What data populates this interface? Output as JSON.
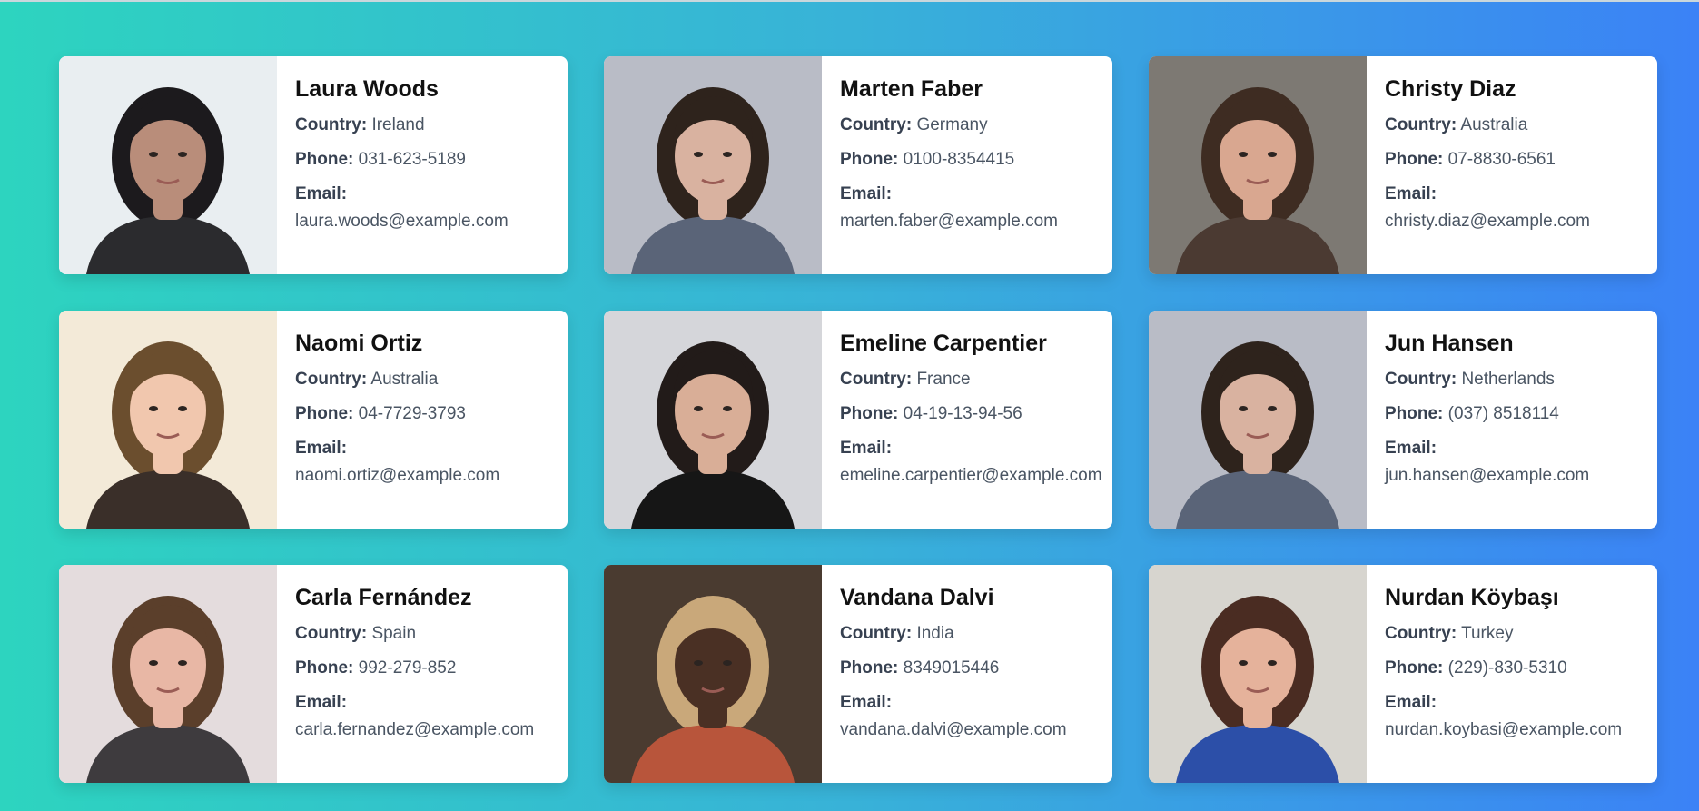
{
  "labels": {
    "country": "Country:",
    "phone": "Phone:",
    "email": "Email:"
  },
  "people": [
    {
      "name": "Laura Woods",
      "country": "Ireland",
      "phone": "031-623-5189",
      "email": "laura.woods@example.com",
      "bg": "#e9eef1",
      "hair": "#1c1a1d",
      "skin": "#b98d7a",
      "shirt": "#2b2b2e",
      "avatar_icon": "portrait-woman-glasses-icon"
    },
    {
      "name": "Marten Faber",
      "country": "Germany",
      "phone": "0100-8354415",
      "email": "marten.faber@example.com",
      "bg": "#b9bcc6",
      "hair": "#2e231c",
      "skin": "#d9b2a0",
      "shirt": "#5a6478",
      "avatar_icon": "portrait-man-suit-icon"
    },
    {
      "name": "Christy Diaz",
      "country": "Australia",
      "phone": "07-8830-6561",
      "email": "christy.diaz@example.com",
      "bg": "#7d7973",
      "hair": "#3e2c22",
      "skin": "#d9a790",
      "shirt": "#4b3a32",
      "avatar_icon": "portrait-woman-glasses-icon"
    },
    {
      "name": "Naomi Ortiz",
      "country": "Australia",
      "phone": "04-7729-3793",
      "email": "naomi.ortiz@example.com",
      "bg": "#f3ead8",
      "hair": "#6b4e2e",
      "skin": "#f1c7ae",
      "shirt": "#3a2f29",
      "avatar_icon": "portrait-woman-icon"
    },
    {
      "name": "Emeline Carpentier",
      "country": "France",
      "phone": "04-19-13-94-56",
      "email": "emeline.carpentier@example.com",
      "bg": "#d5d6da",
      "hair": "#221b19",
      "skin": "#d9ae97",
      "shirt": "#161616",
      "avatar_icon": "portrait-woman-icon"
    },
    {
      "name": "Jun Hansen",
      "country": "Netherlands",
      "phone": "(037) 8518114",
      "email": "jun.hansen@example.com",
      "bg": "#b9bcc6",
      "hair": "#2e231c",
      "skin": "#d9b2a0",
      "shirt": "#5a6478",
      "avatar_icon": "portrait-man-suit-icon"
    },
    {
      "name": "Carla Fernández",
      "country": "Spain",
      "phone": "992-279-852",
      "email": "carla.fernandez@example.com",
      "bg": "#e4dcdd",
      "hair": "#5b3f2b",
      "skin": "#e8b7a5",
      "shirt": "#3e3b3e",
      "avatar_icon": "portrait-woman-icon"
    },
    {
      "name": "Vandana Dalvi",
      "country": "India",
      "phone": "8349015446",
      "email": "vandana.dalvi@example.com",
      "bg": "#4a3b30",
      "hair": "#c9a87a",
      "skin": "#4a3024",
      "shirt": "#b8553b",
      "avatar_icon": "portrait-woman-headwrap-icon"
    },
    {
      "name": "Nurdan Köybaşı",
      "country": "Turkey",
      "phone": "(229)-830-5310",
      "email": "nurdan.koybasi@example.com",
      "bg": "#d7d5cf",
      "hair": "#4a2c22",
      "skin": "#e5b29b",
      "shirt": "#2c4fa8",
      "avatar_icon": "portrait-woman-icon"
    }
  ]
}
